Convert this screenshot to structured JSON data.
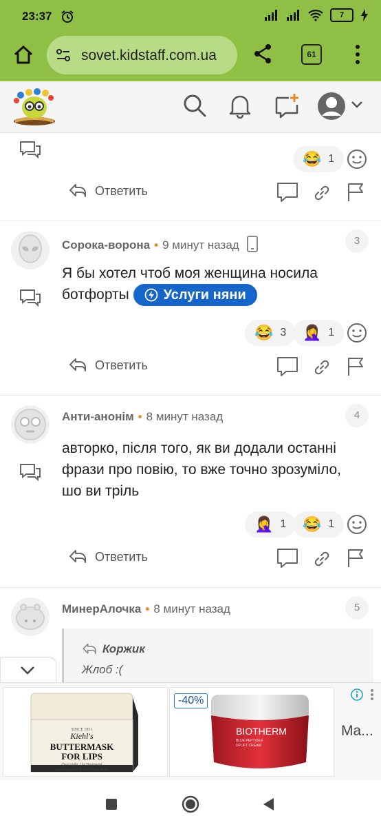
{
  "status_bar": {
    "time": "23:37",
    "battery": "7"
  },
  "browser": {
    "url": "sovet.kidstaff.com.ua",
    "tab_count": "61"
  },
  "comments": [
    {
      "id": "c0",
      "reactions": [
        {
          "emoji": "😂",
          "count": "1"
        }
      ],
      "reply_label": "Ответить"
    },
    {
      "id": "c1",
      "author": "Сорока-ворона",
      "time": "9 минут назад",
      "number": "3",
      "text_line1": "Я бы хотел чтоб моя женщина носила",
      "text_line2": "ботфорты",
      "badge_label": "Услуги няни",
      "reactions": [
        {
          "emoji": "😂",
          "count": "3"
        },
        {
          "emoji": "🤦‍♀️",
          "count": "1"
        }
      ],
      "reply_label": "Ответить"
    },
    {
      "id": "c2",
      "author": "Анти-анонім",
      "time": "8 минут назад",
      "number": "4",
      "text_line1": "авторко, після того, як ви додали останні",
      "text_line2": "фрази про повію, то вже точно зрозуміло,",
      "text_line3": "шо ви тріль",
      "reactions": [
        {
          "emoji": "🤦‍♀️",
          "count": "1"
        },
        {
          "emoji": "😂",
          "count": "1"
        }
      ],
      "reply_label": "Ответить"
    },
    {
      "id": "c3",
      "author": "МинерАлочка",
      "time": "8 минут назад",
      "number": "5",
      "quote_author": "Коржик",
      "quote_text": "Жлоб :("
    }
  ],
  "ads": {
    "ad1": {
      "brand": "Kiehl's",
      "line1": "BUTTERMASK",
      "line2": "FOR LIPS",
      "line3": "Overnight Lip Treatment",
      "line4": "with Coconut Oil & Wild Mango Butter",
      "since": "SINCE 1851"
    },
    "ad2": {
      "discount": "-40%",
      "brand": "BIOTHERM",
      "sub1": "BLUE PEPTIDES",
      "sub2": "UPLIFT CREAM"
    },
    "ad3_label": "Ma..."
  },
  "colors": {
    "browser_bar": "#8fc045",
    "url_pill": "#b8dc86",
    "accent_button": "#1665c8",
    "meta_dot": "#e38b2c"
  }
}
